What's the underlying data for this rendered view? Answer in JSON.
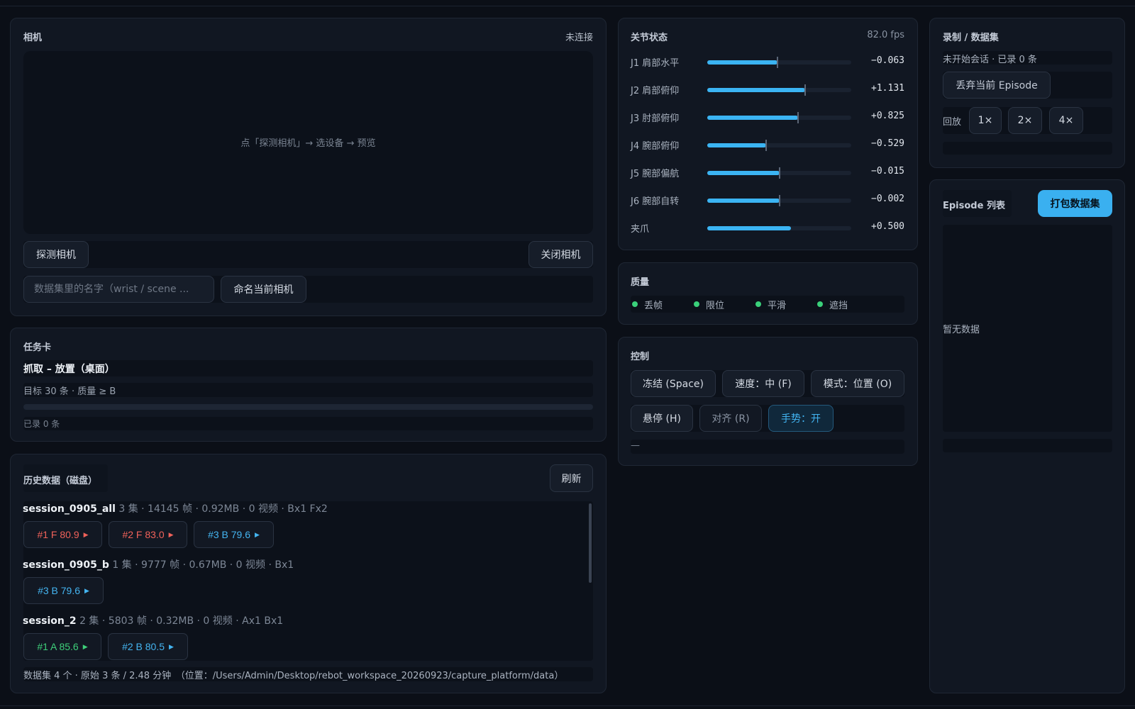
{
  "camera": {
    "title": "相机",
    "status": "未连接",
    "preview_hint": "点「探测相机」→ 选设备 → 预览",
    "probe_button": "探测相机",
    "close_button": "关闭相机",
    "name_input_placeholder": "数据集里的名字（wrist / scene ...",
    "name_button": "命名当前相机"
  },
  "task": {
    "title": "任务卡",
    "name": "抓取 – 放置（桌面）",
    "target": "目标 30 条 · 质量 ≥ B",
    "progress": 0,
    "recorded": "已录 0 条"
  },
  "history": {
    "title": "历史数据（磁盘）",
    "refresh_button": "刷新",
    "sessions": [
      {
        "name": "session_0905_all",
        "meta": "3 集 · 14145 帧 · 0.92MB · 0 视频 · Bx1 Fx2",
        "episodes": [
          {
            "label": "#1 F 80.9",
            "grade": "F"
          },
          {
            "label": "#2 F 83.0",
            "grade": "F"
          },
          {
            "label": "#3 B 79.6",
            "grade": "B"
          }
        ]
      },
      {
        "name": "session_0905_b",
        "meta": "1 集 · 9777 帧 · 0.67MB · 0 视频 · Bx1",
        "episodes": [
          {
            "label": "#3 B 79.6",
            "grade": "B"
          }
        ]
      },
      {
        "name": "session_2",
        "meta": "2 集 · 5803 帧 · 0.32MB · 0 视频 · Ax1 Bx1",
        "episodes": [
          {
            "label": "#1 A 85.6",
            "grade": "A"
          },
          {
            "label": "#2 B 80.5",
            "grade": "B"
          }
        ]
      }
    ],
    "footer": "数据集 4 个 · 原始 3 条 / 2.48 分钟　（位置：/Users/Admin/Desktop/rebot_workspace_20260923/capture_platform/data）"
  },
  "joints": {
    "title": "关节状态",
    "fps": "82.0 fps",
    "items": [
      {
        "label": "J1 肩部水平",
        "value": "−0.063",
        "fill": 0.49,
        "marker": 0.49
      },
      {
        "label": "J2 肩部俯仰",
        "value": "+1.131",
        "fill": 0.68,
        "marker": 0.68
      },
      {
        "label": "J3 肘部俯仰",
        "value": "+0.825",
        "fill": 0.63,
        "marker": 0.63
      },
      {
        "label": "J4 腕部俯仰",
        "value": "−0.529",
        "fill": 0.41,
        "marker": 0.41
      },
      {
        "label": "J5 腕部偏航",
        "value": "−0.015",
        "fill": 0.5,
        "marker": 0.5
      },
      {
        "label": "J6 腕部自转",
        "value": "−0.002",
        "fill": 0.5,
        "marker": 0.5
      },
      {
        "label": "夹爪",
        "value": "+0.500",
        "fill": 0.58,
        "marker": null
      }
    ]
  },
  "quality": {
    "title": "质量",
    "items": [
      "丢帧",
      "限位",
      "平滑",
      "遮挡"
    ],
    "dot_color": "#3ad07a"
  },
  "control": {
    "title": "控制",
    "freeze_button": "冻结 (Space)",
    "speed_button": "速度：中 (F)",
    "mode_button": "模式：位置 (O)",
    "hover_button": "悬停 (H)",
    "align_button": "对齐 (R)",
    "gesture_button": "手势：开",
    "status": "—"
  },
  "recording": {
    "title": "录制 / 数据集",
    "status": "未开始会话 · 已录 0 条",
    "discard_button": "丢弃当前 Episode",
    "playback_label": "回放",
    "speeds": [
      "1×",
      "2×",
      "4×"
    ]
  },
  "episodes": {
    "title": "Episode 列表",
    "pack_button": "打包数据集",
    "empty": "暂无数据"
  },
  "colors": {
    "accent": "#3ab0f0",
    "grade_F": "#f0625a",
    "grade_B": "#44b4f0",
    "grade_A": "#3ecf7a"
  }
}
